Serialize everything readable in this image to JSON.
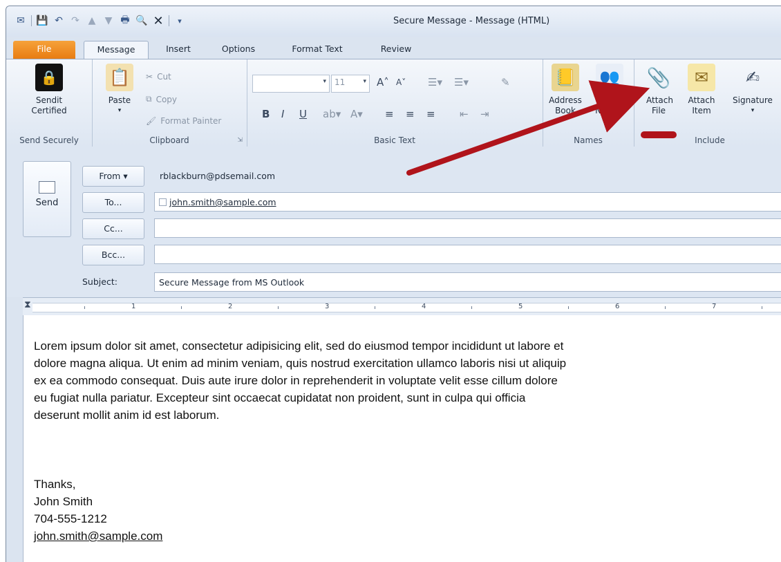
{
  "window": {
    "title": "Secure Message  -  Message (HTML)"
  },
  "tabs": [
    {
      "label": "File"
    },
    {
      "label": "Message"
    },
    {
      "label": "Insert"
    },
    {
      "label": "Options"
    },
    {
      "label": "Format Text"
    },
    {
      "label": "Review"
    }
  ],
  "ribbon": {
    "send_securely": {
      "button": "Sendit Certified",
      "group": "Send Securely"
    },
    "clipboard": {
      "paste": "Paste",
      "cut": "Cut",
      "copy": "Copy",
      "format_painter": "Format Painter",
      "group": "Clipboard"
    },
    "basic_text": {
      "font_size": "11",
      "group": "Basic Text"
    },
    "names": {
      "address_book": "Address Book",
      "check_names": "Check Names",
      "group": "Names"
    },
    "include": {
      "attach_file": "Attach File",
      "attach_item": "Attach Item",
      "signature": "Signature",
      "group": "Include"
    }
  },
  "compose": {
    "send_label": "Send",
    "from_label": "From",
    "from_value": "rblackburn@pdsemail.com",
    "to_label": "To...",
    "to_value": "john.smith@sample.com",
    "cc_label": "Cc...",
    "bcc_label": "Bcc...",
    "subject_label": "Subject:",
    "subject_value": "Secure Message from MS Outlook"
  },
  "ruler": {
    "numbers": [
      "1",
      "2",
      "3",
      "4",
      "5",
      "6",
      "7"
    ]
  },
  "body": {
    "paragraph": "Lorem ipsum dolor sit amet, consectetur adipisicing elit, sed do eiusmod tempor incididunt ut labore et dolore magna aliqua. Ut enim ad minim veniam, quis nostrud exercitation ullamco laboris nisi ut aliquip ex ea commodo consequat. Duis aute irure dolor in reprehenderit in voluptate velit esse cillum dolore eu fugiat nulla pariatur. Excepteur sint occaecat cupidatat non proident, sunt in culpa qui officia deserunt mollit anim id est laborum.",
    "signature": {
      "thanks": "Thanks,",
      "name": "John Smith",
      "phone": "704-555-1212",
      "email": "john.smith@sample.com"
    }
  },
  "colors": {
    "file_tab": "#e87c12",
    "annotation_red": "#b0141b",
    "ribbon_bg": "#dde6f2"
  }
}
